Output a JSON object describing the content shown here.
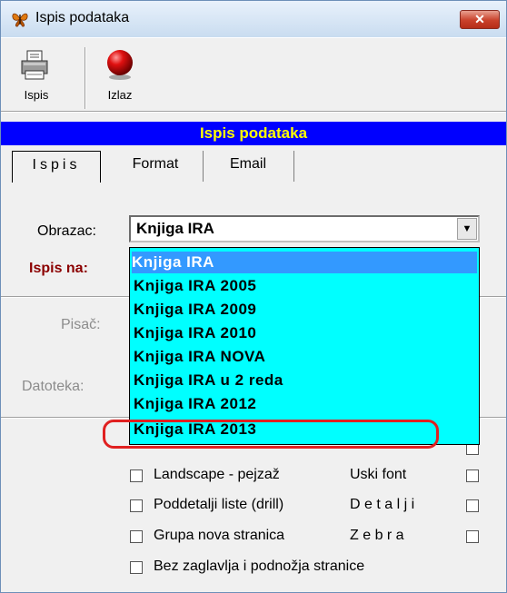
{
  "window": {
    "title": "Ispis podataka",
    "close_label": "✕"
  },
  "toolbar": {
    "print_label": "Ispis",
    "exit_label": "Izlaz"
  },
  "header": {
    "title": "Ispis podataka"
  },
  "tabs": [
    {
      "label": "Ispis"
    },
    {
      "label": "Format"
    },
    {
      "label": "Email"
    }
  ],
  "form": {
    "obrazac_label": "Obrazac:",
    "obrazac_value": "Knjiga IRA",
    "ispis_na_label": "Ispis na:",
    "pisac_label": "Pisač:",
    "datoteka_label": "Datoteka:"
  },
  "dropdown": {
    "options": [
      "Knjiga IRA",
      "Knjiga IRA 2005",
      "Knjiga IRA 2009",
      "Knjiga IRA 2010",
      "Knjiga IRA NOVA",
      "Knjiga IRA u 2 reda",
      "Knjiga IRA 2012",
      "Knjiga IRA 2013"
    ],
    "selected": "Knjiga IRA"
  },
  "options": {
    "landscape": "Landscape - pejzaž",
    "uski_font": "Uski font",
    "poddetalji": "Poddetalji liste (drill)",
    "detalji": "D e t a l j i",
    "grupa": "Grupa nova stranica",
    "zebra": "Z e b r a",
    "bez_zaglavlja": "Bez zaglavlja i podnožja stranice"
  },
  "colors": {
    "header_bg": "#0000ff",
    "header_fg": "#ffff00",
    "dropdown_bg": "#00ffff",
    "selection": "#3399ff",
    "annotation": "#e02020"
  }
}
